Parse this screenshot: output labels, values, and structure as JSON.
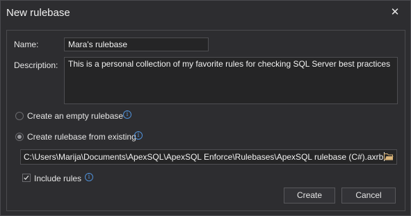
{
  "window": {
    "title": "New rulebase",
    "close_glyph": "✕"
  },
  "form": {
    "name_label": "Name:",
    "name_value": "Mara's rulebase",
    "description_label": "Description:",
    "description_value": "This is a personal collection of my favorite rules for checking SQL Server best practices",
    "option_empty_label": "Create an empty rulebase",
    "option_existing_label": "Create rulebase from existing",
    "selected_option": "existing",
    "existing_path": "C:\\Users\\Marija\\Documents\\ApexSQL\\ApexSQL Enforce\\Rulebases\\ApexSQL rulebase (C#).axrb",
    "include_rules_label": "Include rules",
    "include_rules_checked": true,
    "info_glyph": "i"
  },
  "buttons": {
    "create_label": "Create",
    "cancel_label": "Cancel"
  },
  "icons": {
    "close": "close-icon",
    "info": "info-icon",
    "folder": "folder-icon",
    "check": "checkmark-icon"
  },
  "colors": {
    "background": "#2d2d30",
    "input_background": "#252526",
    "border": "#4a4a4e",
    "info_blue": "#4f8fd6",
    "folder_yellow": "#dcb67a"
  }
}
